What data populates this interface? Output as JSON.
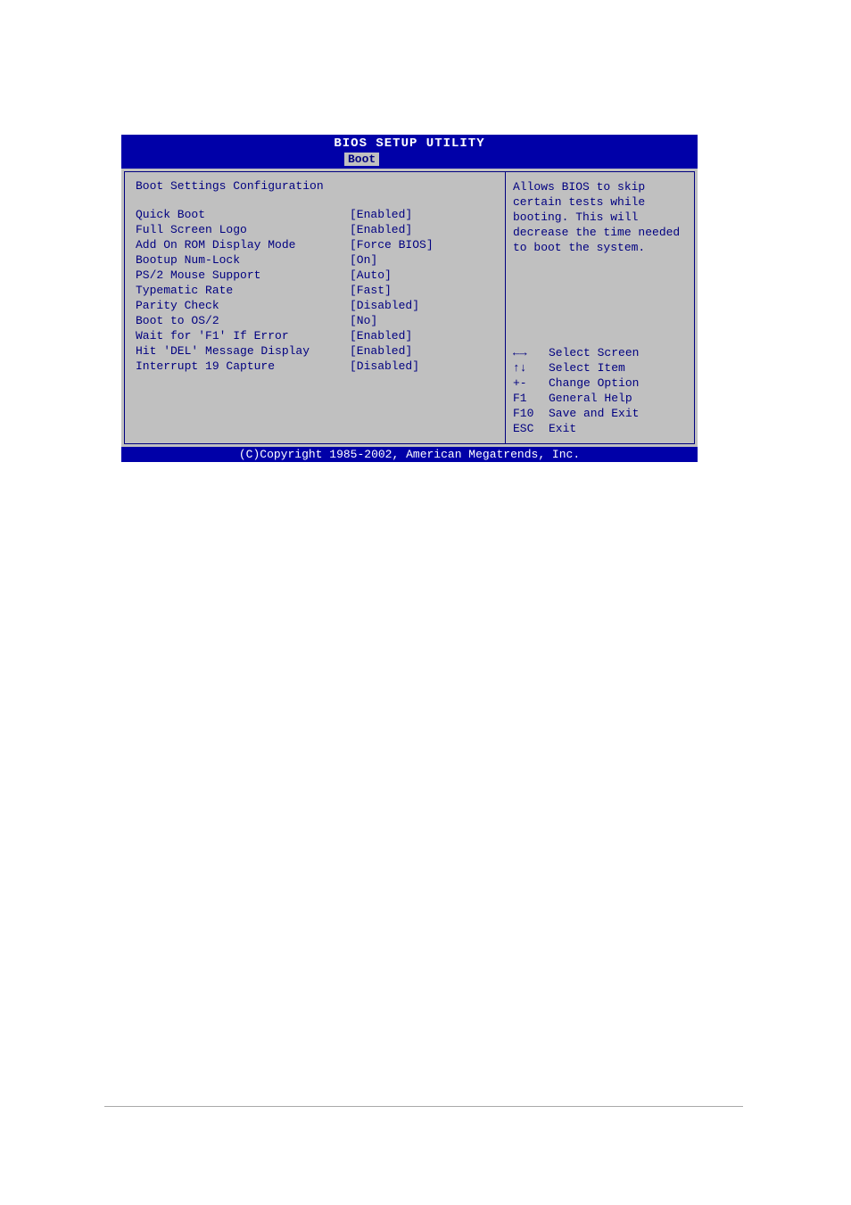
{
  "title": "BIOS SETUP UTILITY",
  "tab": "Boot",
  "section_title": "Boot Settings Configuration",
  "settings": [
    {
      "label": "Quick Boot",
      "value": "[Enabled]"
    },
    {
      "label": "Full Screen Logo",
      "value": "[Enabled]"
    },
    {
      "label": "Add On ROM Display Mode",
      "value": "[Force BIOS]"
    },
    {
      "label": "Bootup Num-Lock",
      "value": "[On]"
    },
    {
      "label": "PS/2 Mouse Support",
      "value": "[Auto]"
    },
    {
      "label": "Typematic Rate",
      "value": "[Fast]"
    },
    {
      "label": "Parity Check",
      "value": "[Disabled]"
    },
    {
      "label": "Boot to OS/2",
      "value": "[No]"
    },
    {
      "label": "Wait for 'F1' If Error",
      "value": "[Enabled]"
    },
    {
      "label": "Hit 'DEL' Message Display",
      "value": "[Enabled]"
    },
    {
      "label": "Interrupt 19 Capture",
      "value": "[Disabled]"
    }
  ],
  "help_text": "Allows BIOS to skip certain tests while booting. This will decrease the time needed to boot the system.",
  "key_hints": [
    {
      "key": "←→",
      "action": "Select Screen"
    },
    {
      "key": "↑↓",
      "action": "Select Item"
    },
    {
      "key": "+-",
      "action": "Change Option"
    },
    {
      "key": "F1",
      "action": "General Help"
    },
    {
      "key": "F10",
      "action": "Save and Exit"
    },
    {
      "key": "ESC",
      "action": "Exit"
    }
  ],
  "footer": "(C)Copyright 1985-2002, American Megatrends, Inc."
}
